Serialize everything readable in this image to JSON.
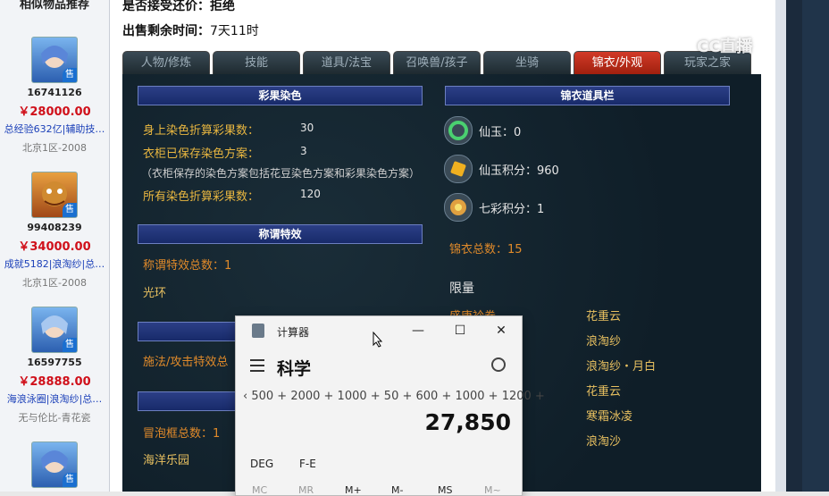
{
  "sidebar": {
    "title": "相似物品推荐",
    "items": [
      {
        "id": "16741126",
        "price": "￥28000.00",
        "desc": "总经验632亿|辅助技…",
        "server": "北京1区-2008"
      },
      {
        "id": "99408239",
        "price": "￥34000.00",
        "desc": "成就5182|浪淘纱|总…",
        "server": "北京1区-2008"
      },
      {
        "id": "16597755",
        "price": "￥28888.00",
        "desc": "海浪泳圈|浪淘纱|总…",
        "server": "无与伦比-青花瓷"
      }
    ],
    "sell_badge": "售"
  },
  "main": {
    "info1": "是否接受还价：拒绝",
    "info2_label": "出售剩余时间：",
    "info2_value": "7天11时",
    "tabs": [
      "人物/修炼",
      "技能",
      "道具/法宝",
      "召唤兽/孩子",
      "坐骑",
      "锦衣/外观",
      "玩家之家"
    ],
    "active_tab": "锦衣/外观"
  },
  "left_col": {
    "color_header": "彩果染色",
    "color_rows": [
      {
        "label": "身上染色折算彩果数：",
        "value": "30"
      },
      {
        "label": "衣柜已保存染色方案：",
        "value": "3"
      }
    ],
    "color_note": "（衣柜保存的染色方案包括花豆染色方案和彩果染色方案）",
    "color_total_label": "所有染色折算彩果数：",
    "color_total_value": "120",
    "title_header": "称谓特效",
    "title_count": "称谓特效总数：1",
    "title_item": "光环",
    "cast_count": "施法/攻击特效总",
    "bubble_count": "冒泡框总数：1",
    "bubble_item": "海洋乐园"
  },
  "right_col": {
    "header": "锦衣道具栏",
    "currencies": [
      "仙玉：0",
      "仙玉积分：960",
      "七彩积分：1"
    ],
    "total": "锦衣总数：15",
    "limited_label": "限量",
    "limited_left": [
      "盛唐衿卷"
    ],
    "limited_right": [
      "花重云",
      "浪淘纱",
      "浪淘纱・月白",
      "花重云",
      "寒霜冰凌",
      "浪淘沙"
    ]
  },
  "calculator": {
    "title": "计算器",
    "mode": "科学",
    "expression": "500 + 2000 + 1000 + 50 + 600 + 1000 + 1200 +",
    "result": "27,850",
    "deg": "DEG",
    "fe": "F-E",
    "memory": [
      "MC",
      "MR",
      "M+",
      "M-",
      "MS",
      "M~"
    ]
  },
  "watermark": "CC直播"
}
